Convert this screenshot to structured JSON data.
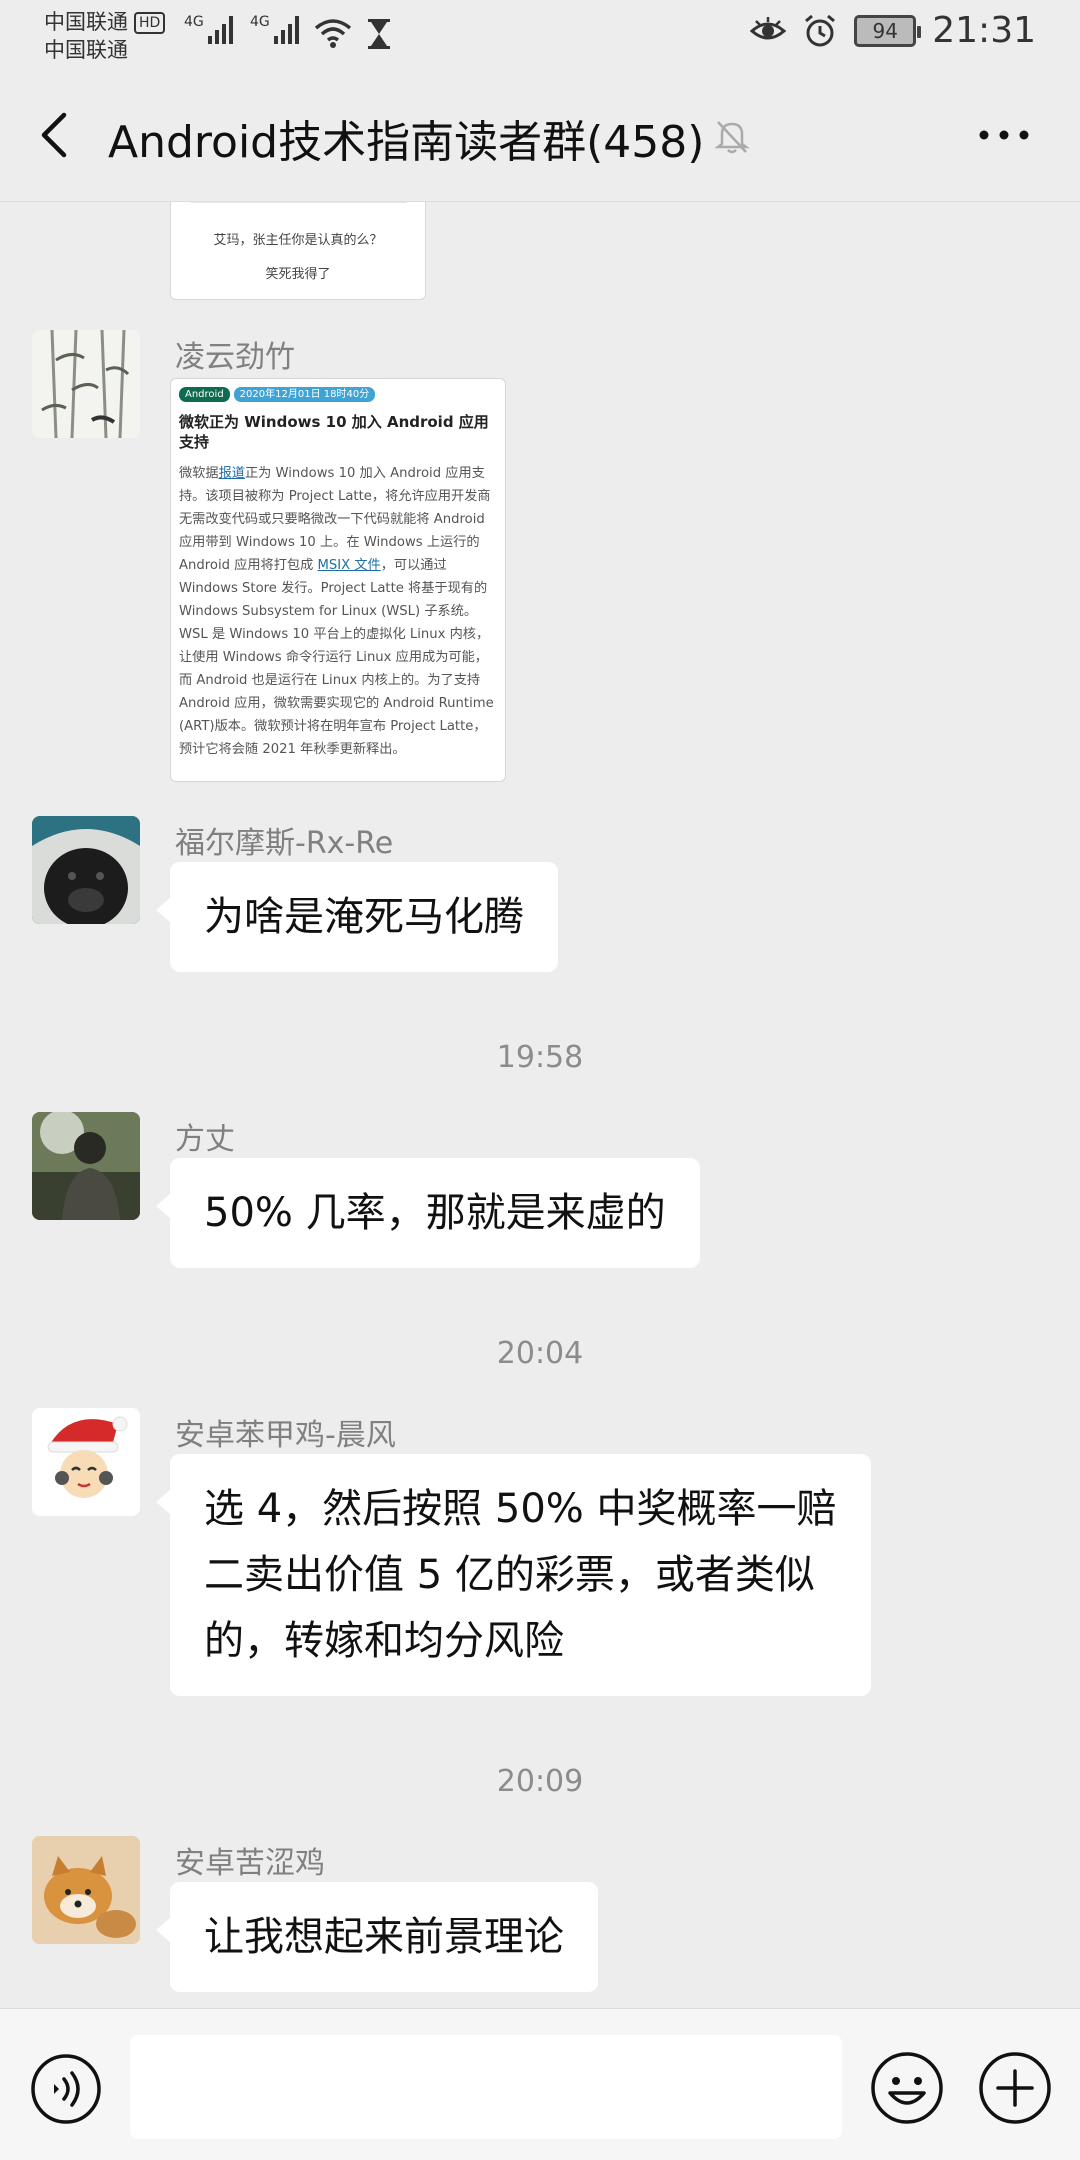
{
  "status_bar": {
    "carrier1": "中国联通",
    "carrier2": "中国联通",
    "hd": "HD",
    "net1": "4G",
    "net2": "4G",
    "battery": "94",
    "time": "21:31"
  },
  "header": {
    "title": "Android技术指南读者群(458)"
  },
  "partial_card": {
    "line1": "艾玛，张主任你是认真的么？",
    "line2": "笑死我得了"
  },
  "messages": [
    {
      "sender": "凌云劲竹",
      "card": {
        "tag1": "Android",
        "tag2": "2020年12月01日 18时40分",
        "title": "微软正为 Windows 10 加入 Android 应用支持",
        "body_pre": "微软据",
        "body_link1": "报道",
        "body_mid": "正为 Windows 10 加入 Android 应用支持。该项目被称为 Project Latte，将允许应用开发商无需改变代码或只要略微改一下代码就能将 Android 应用带到 Windows 10 上。在 Windows 上运行的 Android 应用将打包成 ",
        "body_link2": "MSIX 文件",
        "body_post": "，可以通过 Windows Store 发行。Project Latte 将基于现有的 Windows Subsystem for Linux (WSL) 子系统。WSL 是 Windows 10 平台上的虚拟化 Linux 内核，让使用 Windows 命令行运行 Linux 应用成为可能，而 Android 也是运行在 Linux 内核上的。为了支持 Android 应用，微软需要实现它的 Android Runtime (ART)版本。微软预计将在明年宣布 Project Latte，预计它将会随 2021 年秋季更新释出。"
      }
    },
    {
      "sender": "福尔摩斯-Rx-Re",
      "text": "为啥是淹死马化腾"
    },
    {
      "time": "19:58"
    },
    {
      "sender": "方丈",
      "text": "50% 几率，那就是来虚的"
    },
    {
      "time": "20:04"
    },
    {
      "sender": "安卓苯甲鸡-晨风",
      "lines": [
        "选 4，然后按照 50% 中奖概率一赔",
        "二卖出价值 5 亿的彩票，或者类似",
        "的，转嫁和均分风险"
      ]
    },
    {
      "time": "20:09"
    },
    {
      "sender": "安卓苦涩鸡",
      "text": "让我想起来前景理论"
    }
  ],
  "input": {
    "placeholder": ""
  }
}
